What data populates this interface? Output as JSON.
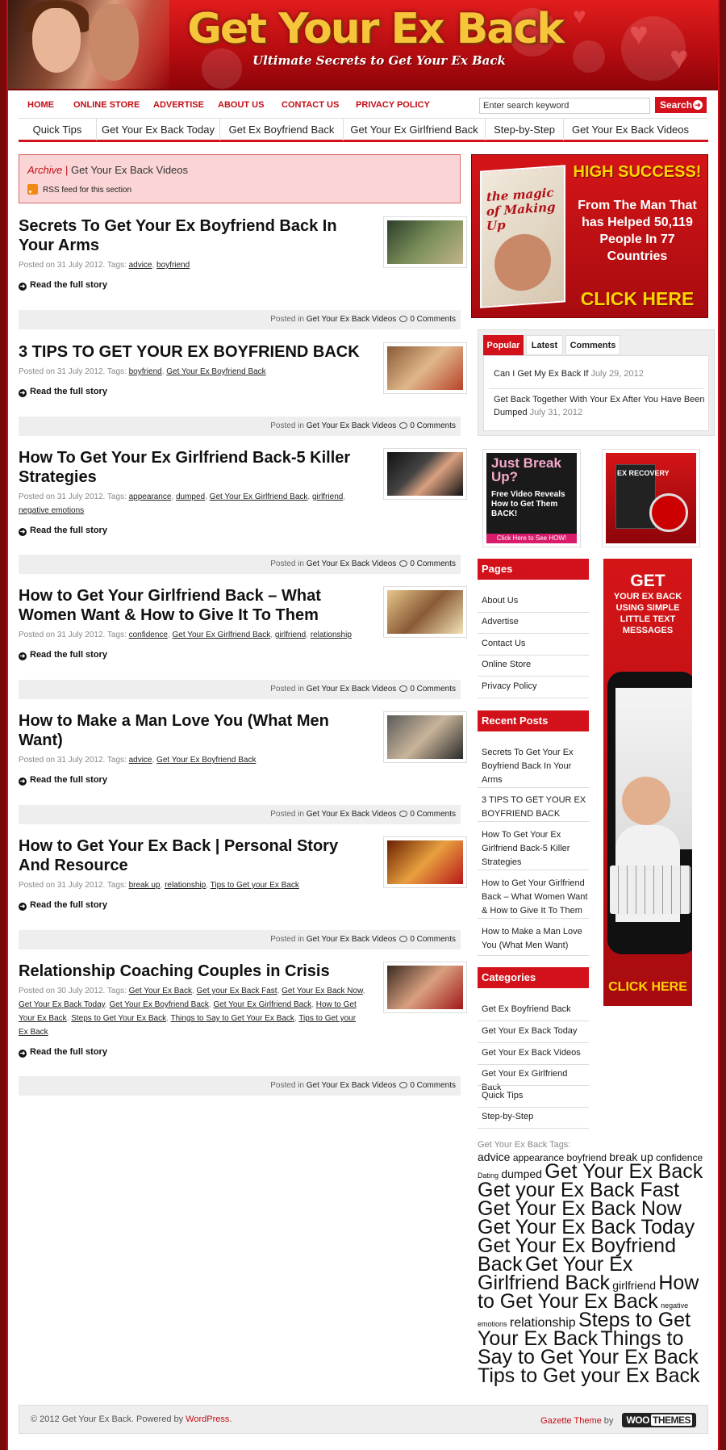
{
  "header": {
    "title": "Get Your Ex Back",
    "tagline": "Ultimate Secrets to Get Your Ex Back"
  },
  "topnav": [
    "HOME",
    "ONLINE STORE",
    "ADVERTISE",
    "ABOUT US",
    "CONTACT US",
    "PRIVACY POLICY"
  ],
  "search": {
    "placeholder": "Enter search keyword",
    "button": "Search"
  },
  "catnav": [
    "Quick Tips",
    "Get Your Ex Back Today",
    "Get Ex Boyfriend Back",
    "Get Your Ex Girlfriend Back",
    "Step-by-Step",
    "Get Your Ex Back Videos"
  ],
  "archive": {
    "label": "Archive",
    "separator": "|",
    "title": "Get Your Ex Back Videos",
    "rss": "RSS feed for this section"
  },
  "post_common": {
    "read_more": "Read the full story",
    "posted_in": "Posted in",
    "comments": "0 Comments",
    "category": "Get Your Ex Back Videos"
  },
  "posts": [
    {
      "title": "Secrets To Get Your Ex Boyfriend Back In Your Arms",
      "posted": "Posted on 31 July 2012. Tags:",
      "tags": [
        "advice",
        "boyfriend"
      ]
    },
    {
      "title": "3 TIPS TO GET YOUR EX BOYFRIEND BACK",
      "posted": "Posted on 31 July 2012. Tags:",
      "tags": [
        "boyfriend",
        "Get Your Ex Boyfriend Back"
      ]
    },
    {
      "title": "How To Get Your Ex Girlfriend Back-5 Killer Strategies",
      "posted": "Posted on 31 July 2012. Tags:",
      "tags": [
        "appearance",
        "dumped",
        "Get Your Ex Girlfriend Back",
        "girlfriend",
        "negative emotions"
      ]
    },
    {
      "title": "How to Get Your Girlfriend Back – What Women Want & How to Give It To Them",
      "posted": "Posted on 31 July 2012. Tags:",
      "tags": [
        "confidence",
        "Get Your Ex Girlfriend Back",
        "girlfriend",
        "relationship"
      ]
    },
    {
      "title": "How to Make a Man Love You (What Men Want)",
      "posted": "Posted on 31 July 2012. Tags:",
      "tags": [
        "advice",
        "Get Your Ex Boyfriend Back"
      ]
    },
    {
      "title": "How to Get Your Ex Back | Personal Story And Resource",
      "posted": "Posted on 31 July 2012. Tags:",
      "tags": [
        "break up",
        "relationship",
        "Tips to Get your Ex Back"
      ]
    },
    {
      "title": "Relationship Coaching Couples in Crisis",
      "posted": "Posted on 30 July 2012. Tags:",
      "tags": [
        "Get Your Ex Back",
        "Get your Ex Back Fast",
        "Get Your Ex Back Now",
        "Get Your Ex Back Today",
        "Get Your Ex Boyfriend Back",
        "Get Your Ex Girlfriend Back",
        "How to Get Your Ex Back",
        "Steps to Get Your Ex Back",
        "Things to Say to Get Your Ex Back",
        "Tips to Get your Ex Back"
      ]
    }
  ],
  "ads": {
    "big": {
      "book_title": "the magic of Making Up",
      "headline": "HIGH SUCCESS!",
      "body": "From The Man That has Helped 50,119 People In 77 Countries",
      "cta": "CLICK HERE"
    },
    "breakup": {
      "line1": "Just Break Up?",
      "line2": "Free Video Reveals How to Get Them BACK!",
      "cta": "Click Here to See HOW!"
    },
    "recovery": {
      "label": "EX RECOVERY"
    },
    "tall": {
      "headline": "GET",
      "body": "YOUR EX BACK USING SIMPLE LITTLE TEXT MESSAGES",
      "cta": "CLICK HERE"
    }
  },
  "tabs": {
    "labels": [
      "Popular",
      "Latest",
      "Comments"
    ],
    "items": [
      {
        "title": "Can I Get My Ex Back If",
        "date": "July 29, 2012"
      },
      {
        "title": "Get Back Together With Your Ex After You Have Been Dumped",
        "date": "July 31, 2012"
      }
    ]
  },
  "pages_widget": {
    "title": "Pages",
    "items": [
      "About Us",
      "Advertise",
      "Contact Us",
      "Online Store",
      "Privacy Policy"
    ]
  },
  "recent_widget": {
    "title": "Recent Posts",
    "items": [
      "Secrets To Get Your Ex Boyfriend Back In Your Arms",
      "3 TIPS TO GET YOUR EX BOYFRIEND BACK",
      "How To Get Your Ex Girlfriend Back-5 Killer Strategies",
      "How to Get Your Girlfriend Back – What Women Want & How to Give It To Them",
      "How to Make a Man Love You (What Men Want)"
    ]
  },
  "categories_widget": {
    "title": "Categories",
    "items": [
      "Get Ex Boyfriend Back",
      "Get Your Ex Back Today",
      "Get Your Ex Back Videos",
      "Get Your Ex Girlfriend Back",
      "Quick Tips",
      "Step-by-Step"
    ]
  },
  "tagcloud": {
    "title": "Get Your Ex Back Tags:",
    "tags": [
      {
        "label": "advice",
        "weight": 2
      },
      {
        "label": "appearance",
        "weight": 1
      },
      {
        "label": "boyfriend",
        "weight": 1
      },
      {
        "label": "break up",
        "weight": 2
      },
      {
        "label": "confidence",
        "weight": 1
      },
      {
        "label": "Dating",
        "weight": 0
      },
      {
        "label": "dumped",
        "weight": 2
      },
      {
        "label": "Get Your Ex Back",
        "weight": 4
      },
      {
        "label": "Get your Ex Back Fast",
        "weight": 4
      },
      {
        "label": "Get Your Ex Back Now",
        "weight": 4
      },
      {
        "label": "Get Your Ex Back Today",
        "weight": 4
      },
      {
        "label": "Get Your Ex Boyfriend Back",
        "weight": 4
      },
      {
        "label": "Get Your Ex Girlfriend Back",
        "weight": 4
      },
      {
        "label": "girlfriend",
        "weight": 2
      },
      {
        "label": "How to Get Your Ex Back",
        "weight": 4
      },
      {
        "label": "negative emotions",
        "weight": 0
      },
      {
        "label": "relationship",
        "weight": 3
      },
      {
        "label": "Steps to Get Your Ex Back",
        "weight": 4
      },
      {
        "label": "Things to Say to Get Your Ex Back",
        "weight": 4
      },
      {
        "label": "Tips to Get your Ex Back",
        "weight": 4
      }
    ]
  },
  "footer": {
    "copyright": "© 2012 Get Your Ex Back. Powered by",
    "wordpress": "WordPress",
    "theme": "Gazette Theme",
    "by": "by",
    "woo": "WOO",
    "themes": "THEMES"
  },
  "colors": {
    "brand_red": "#d3111a",
    "dark_red": "#7c0307",
    "gold": "#f6c53a",
    "archive_bg": "#fbd5d5"
  }
}
